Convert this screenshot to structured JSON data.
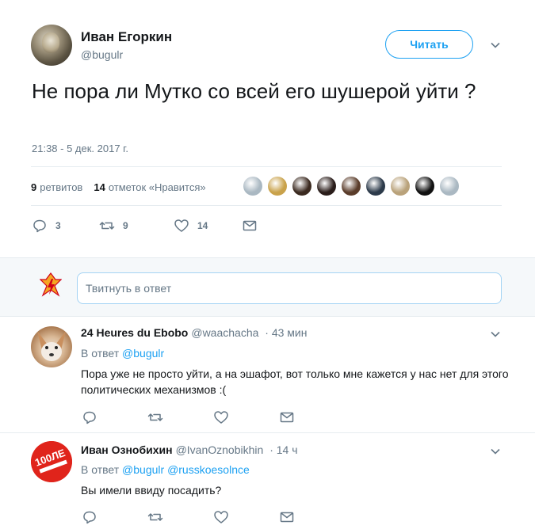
{
  "tweet": {
    "author_name": "Иван Егоркин",
    "author_handle": "@bugulr",
    "follow_label": "Читать",
    "text": "Не пора ли Мутко со всей его шушерой уйти ?",
    "time": "21:38 - 5 дек. 2017 г.",
    "retweets_count": "9",
    "retweets_label": "ретвитов",
    "likes_count": "14",
    "likes_label": "отметок «Нравится»",
    "actions": {
      "reply_count": "3",
      "retweet_count": "9",
      "like_count": "14"
    },
    "liker_colors": [
      "#aab8c2",
      "#c9a24b",
      "#3b2a20",
      "#2a1d1a",
      "#5a3c2a",
      "#2c3a4a",
      "#b9a27a",
      "#111111",
      "#aab8c2"
    ]
  },
  "composer": {
    "placeholder": "Твитнуть в ответ"
  },
  "replies": [
    {
      "name": "24 Heures du Ebobo",
      "handle": "@waachacha",
      "time": "· 43 мин",
      "reply_prefix": "В ответ",
      "mentions": [
        "@bugulr"
      ],
      "text": "Пора уже не просто уйти, а на эшафот, вот только мне кажется у нас нет для этого политических механизмов :("
    },
    {
      "name": "Иван Ознобихин",
      "handle": "@IvanOznobikhin",
      "time": "· 14 ч",
      "reply_prefix": "В ответ",
      "mentions": [
        "@bugulr",
        "@russkoesolnce"
      ],
      "text": "Вы имели ввиду посадить?",
      "avatar_text": "100ЛЕ"
    }
  ],
  "colors": {
    "accent": "#1da1f2",
    "secondary_text": "#657786",
    "divider": "#e6ecf0"
  }
}
